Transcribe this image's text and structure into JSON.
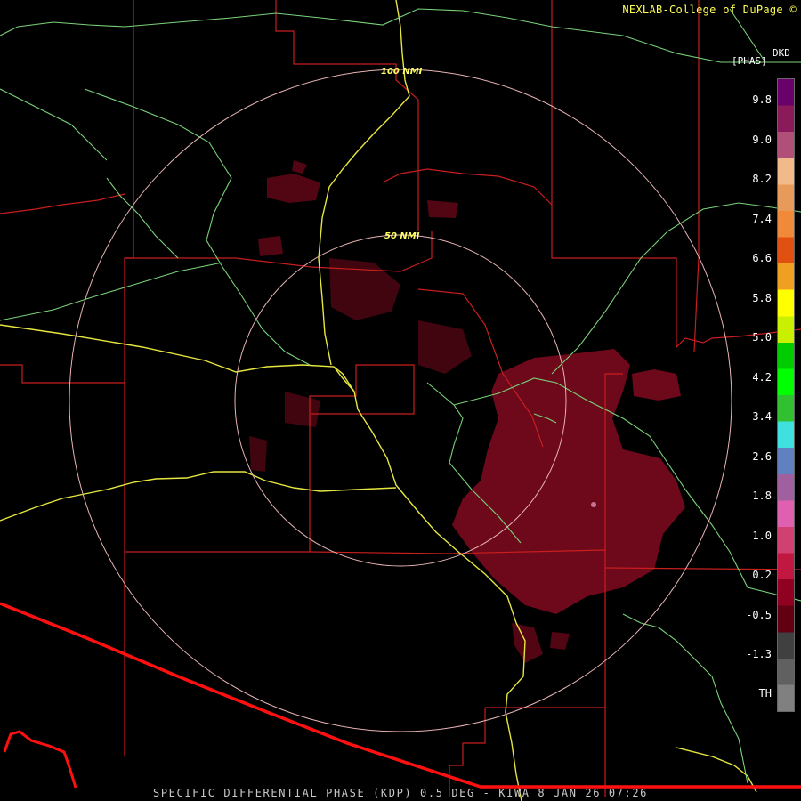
{
  "credit": "NEXLAB-College of DuPage ©",
  "legend": {
    "product_code": "DKD",
    "units": "[PHAS]",
    "scale_labels": [
      "9.8",
      "9.0",
      "8.2",
      "7.4",
      "6.6",
      "5.8",
      "5.0",
      "4.2",
      "3.4",
      "2.6",
      "1.8",
      "1.0",
      "0.2",
      "-0.5",
      "-1.3",
      "TH"
    ],
    "colors": [
      "#6a006a",
      "#8a1a5a",
      "#b05078",
      "#f2b98a",
      "#e89a5a",
      "#f08a3a",
      "#e05010",
      "#f0a020",
      "#ffff00",
      "#c8f000",
      "#00cc00",
      "#00ff00",
      "#30c030",
      "#40e0e0",
      "#6080c0",
      "#a060a0",
      "#e060b0",
      "#d04070",
      "#c01840",
      "#900020",
      "#600010",
      "#404040",
      "#606060",
      "#808080"
    ]
  },
  "rings": {
    "inner": "50 NMI",
    "outer": "100 NMI"
  },
  "footer": "SPECIFIC DIFFERENTIAL PHASE (KDP) 0.5 DEG - KIWA 8 JAN 26 07:26",
  "colors": {
    "boundary": "#c81e1e",
    "highway": "#e6e640",
    "secondary_road": "#7ad27a",
    "ring": "#e8b4b4",
    "echo": "#7a0a1e",
    "border": "#ff1010"
  }
}
